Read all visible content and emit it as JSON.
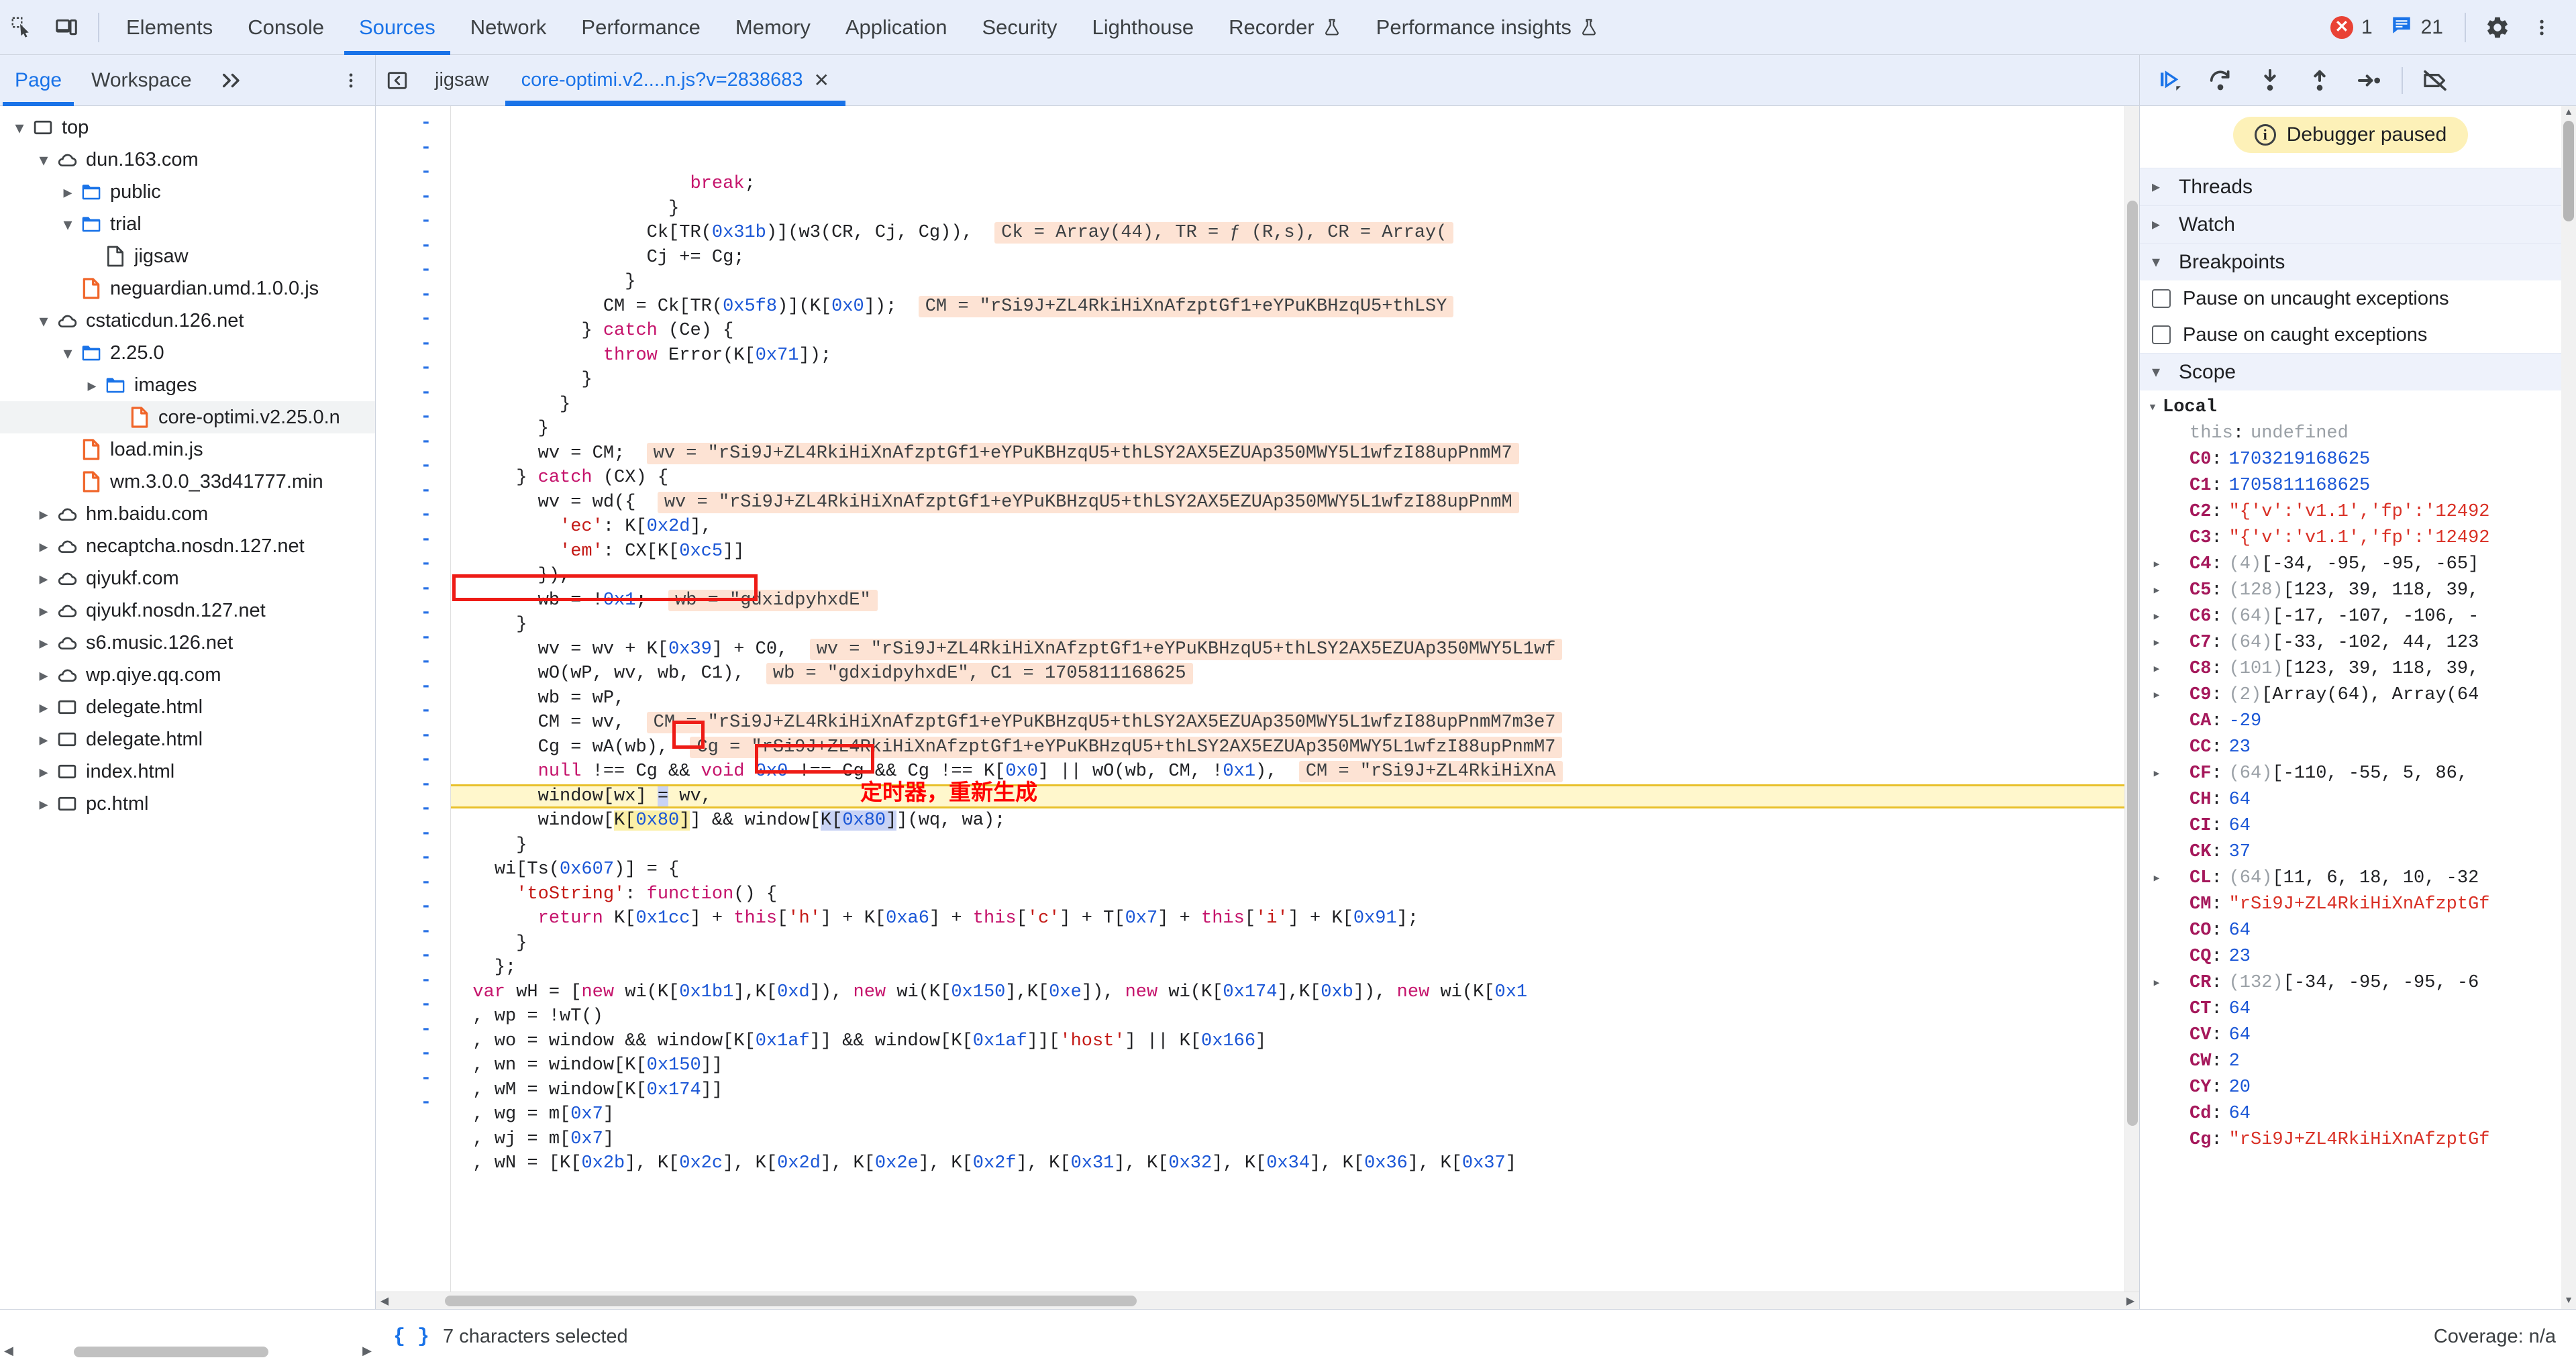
{
  "toolbar": {
    "inspect_icon": "inspect-cursor-icon",
    "device_icon": "device-toolbar-icon",
    "tabs": [
      {
        "label": "Elements",
        "active": false,
        "flask": false
      },
      {
        "label": "Console",
        "active": false,
        "flask": false
      },
      {
        "label": "Sources",
        "active": true,
        "flask": false
      },
      {
        "label": "Network",
        "active": false,
        "flask": false
      },
      {
        "label": "Performance",
        "active": false,
        "flask": false
      },
      {
        "label": "Memory",
        "active": false,
        "flask": false
      },
      {
        "label": "Application",
        "active": false,
        "flask": false
      },
      {
        "label": "Security",
        "active": false,
        "flask": false
      },
      {
        "label": "Lighthouse",
        "active": false,
        "flask": false
      },
      {
        "label": "Recorder",
        "active": false,
        "flask": true
      },
      {
        "label": "Performance insights",
        "active": false,
        "flask": true
      }
    ],
    "error_count": "1",
    "message_count": "21",
    "settings_icon": "gear-icon",
    "more_icon": "more-vertical-icon"
  },
  "navigator": {
    "tabs": [
      {
        "label": "Page",
        "active": true
      },
      {
        "label": "Workspace",
        "active": false
      }
    ],
    "overflow_icon": "chevron-double-right-icon",
    "more_icon": "more-vertical-icon",
    "tree": [
      {
        "label": "top",
        "icon": "frame-icon",
        "indent": 0,
        "state": "open",
        "selected": false
      },
      {
        "label": "dun.163.com",
        "icon": "cloud-icon",
        "indent": 1,
        "state": "open",
        "selected": false
      },
      {
        "label": "public",
        "icon": "folder-icon",
        "indent": 2,
        "state": "closed",
        "selected": false
      },
      {
        "label": "trial",
        "icon": "folder-icon",
        "indent": 2,
        "state": "open",
        "selected": false
      },
      {
        "label": "jigsaw",
        "icon": "file-doc-icon",
        "indent": 3,
        "state": "empty",
        "selected": false
      },
      {
        "label": "neguardian.umd.1.0.0.js",
        "icon": "file-js-icon",
        "indent": 2,
        "state": "empty",
        "selected": false
      },
      {
        "label": "cstaticdun.126.net",
        "icon": "cloud-icon",
        "indent": 1,
        "state": "open",
        "selected": false
      },
      {
        "label": "2.25.0",
        "icon": "folder-icon",
        "indent": 2,
        "state": "open",
        "selected": false
      },
      {
        "label": "images",
        "icon": "folder-icon",
        "indent": 3,
        "state": "closed",
        "selected": false
      },
      {
        "label": "core-optimi.v2.25.0.n",
        "icon": "file-js-icon",
        "indent": 4,
        "state": "empty",
        "selected": true
      },
      {
        "label": "load.min.js",
        "icon": "file-js-icon",
        "indent": 2,
        "state": "empty",
        "selected": false
      },
      {
        "label": "wm.3.0.0_33d41777.min",
        "icon": "file-js-icon",
        "indent": 2,
        "state": "empty",
        "selected": false
      },
      {
        "label": "hm.baidu.com",
        "icon": "cloud-icon",
        "indent": 1,
        "state": "closed",
        "selected": false
      },
      {
        "label": "necaptcha.nosdn.127.net",
        "icon": "cloud-icon",
        "indent": 1,
        "state": "closed",
        "selected": false
      },
      {
        "label": "qiyukf.com",
        "icon": "cloud-icon",
        "indent": 1,
        "state": "closed",
        "selected": false
      },
      {
        "label": "qiyukf.nosdn.127.net",
        "icon": "cloud-icon",
        "indent": 1,
        "state": "closed",
        "selected": false
      },
      {
        "label": "s6.music.126.net",
        "icon": "cloud-icon",
        "indent": 1,
        "state": "closed",
        "selected": false
      },
      {
        "label": "wp.qiye.qq.com",
        "icon": "cloud-icon",
        "indent": 1,
        "state": "closed",
        "selected": false
      },
      {
        "label": "delegate.html",
        "icon": "frame-icon",
        "indent": 1,
        "state": "closed",
        "selected": false
      },
      {
        "label": "delegate.html",
        "icon": "frame-icon",
        "indent": 1,
        "state": "closed",
        "selected": false
      },
      {
        "label": "index.html",
        "icon": "frame-icon",
        "indent": 1,
        "state": "closed",
        "selected": false
      },
      {
        "label": "pc.html",
        "icon": "frame-icon",
        "indent": 1,
        "state": "closed",
        "selected": false
      }
    ]
  },
  "editor": {
    "sidebar_toggle_icon": "show-navigator-icon",
    "tabs": [
      {
        "label": "jigsaw",
        "active": false,
        "closable": false
      },
      {
        "label": "core-optimi.v2....n.js?v=2838683",
        "active": true,
        "closable": true,
        "close_label": "✕"
      }
    ],
    "gutter_marker": "-",
    "annotation_cn": "定时器，重新生成",
    "inline_values": {
      "ck_array": "Ck = Array(44), TR = ƒ (R,s), CR = Array(",
      "cm_value": "CM = \"rSi9J+ZL4RkiHiXnAfzptGf1+eYPuKBHzqU5+thLSY",
      "wv_long": "wv = \"rSi9J+ZL4RkiHiXnAfzptGf1+eYPuKBHzqU5+thLSY2AX5EZUAp350MWY5L1wfzI88upPnmM7",
      "wv_long2": "wv = \"rSi9J+ZL4RkiHiXnAfzptGf1+eYPuKBHzqU5+thLSY2AX5EZUAp350MWY5L1wfzI88upPnmM",
      "wb_value": "wb = \"gdxidpyhxdE\"",
      "wv_c0": "wv = \"rSi9J+ZL4RkiHiXnAfzptGf1+eYPuKBHzqU5+thLSY2AX5EZUAp350MWY5L1wf",
      "wb_c1": "wb = \"gdxidpyhxdE\", C1 = 1705811168625",
      "cm_wv": "CM = \"rSi9J+ZL4RkiHiXnAfzptGf1+eYPuKBHzqU5+thLSY2AX5EZUAp350MWY5L1wfzI88upPnmM7m3e7",
      "cg_wa": "Cg = \"rSi9J+ZL4RkiHiXnAfzptGf1+eYPuKBHzqU5+thLSY2AX5EZUAp350MWY5L1wfzI88upPnmM7",
      "cm_null": "CM = \"rSi9J+ZL4RkiHiXnA"
    }
  },
  "debugger": {
    "buttons": [
      {
        "name": "resume-script-execution",
        "icon": "resume-icon"
      },
      {
        "name": "step-over",
        "icon": "step-over-icon"
      },
      {
        "name": "step-into",
        "icon": "step-into-icon"
      },
      {
        "name": "step-out",
        "icon": "step-out-icon"
      },
      {
        "name": "step",
        "icon": "step-icon"
      },
      {
        "name": "deactivate-breakpoints",
        "icon": "deactivate-breakpoints-icon"
      }
    ],
    "paused_message": "Debugger paused",
    "sections": [
      {
        "label": "Threads",
        "expanded": false
      },
      {
        "label": "Watch",
        "expanded": false
      },
      {
        "label": "Breakpoints",
        "expanded": true
      }
    ],
    "breakpoint_options": [
      {
        "label": "Pause on uncaught exceptions",
        "checked": false
      },
      {
        "label": "Pause on caught exceptions",
        "checked": false
      }
    ],
    "scope_label": "Scope",
    "local_label": "Local",
    "scope_vars": [
      {
        "name": "this",
        "value": "undefined",
        "type": "undef",
        "expandable": false
      },
      {
        "name": "C0",
        "value": "1703219168625",
        "type": "num",
        "expandable": false
      },
      {
        "name": "C1",
        "value": "1705811168625",
        "type": "num",
        "expandable": false
      },
      {
        "name": "C2",
        "value": "\"{'v':'v1.1','fp':'12492",
        "type": "str",
        "expandable": false
      },
      {
        "name": "C3",
        "value": "\"{'v':'v1.1','fp':'12492",
        "type": "str",
        "expandable": false
      },
      {
        "name": "C4",
        "count": "(4)",
        "value": "[-34, -95, -95, -65]",
        "type": "arr",
        "expandable": true
      },
      {
        "name": "C5",
        "count": "(128)",
        "value": "[123, 39, 118, 39,",
        "type": "arr",
        "expandable": true
      },
      {
        "name": "C6",
        "count": "(64)",
        "value": "[-17, -107, -106, -",
        "type": "arr",
        "expandable": true
      },
      {
        "name": "C7",
        "count": "(64)",
        "value": "[-33, -102, 44, 123",
        "type": "arr",
        "expandable": true
      },
      {
        "name": "C8",
        "count": "(101)",
        "value": "[123, 39, 118, 39,",
        "type": "arr",
        "expandable": true
      },
      {
        "name": "C9",
        "count": "(2)",
        "value": "[Array(64), Array(64",
        "type": "arr",
        "expandable": true
      },
      {
        "name": "CA",
        "value": "-29",
        "type": "num",
        "expandable": false
      },
      {
        "name": "CC",
        "value": "23",
        "type": "num",
        "expandable": false
      },
      {
        "name": "CF",
        "count": "(64)",
        "value": "[-110, -55, 5, 86,",
        "type": "arr",
        "expandable": true
      },
      {
        "name": "CH",
        "value": "64",
        "type": "num",
        "expandable": false
      },
      {
        "name": "CI",
        "value": "64",
        "type": "num",
        "expandable": false
      },
      {
        "name": "CK",
        "value": "37",
        "type": "num",
        "expandable": false
      },
      {
        "name": "CL",
        "count": "(64)",
        "value": "[11, 6, 18, 10, -32",
        "type": "arr",
        "expandable": true
      },
      {
        "name": "CM",
        "value": "\"rSi9J+ZL4RkiHiXnAfzptGf",
        "type": "str",
        "expandable": false
      },
      {
        "name": "CO",
        "value": "64",
        "type": "num",
        "expandable": false
      },
      {
        "name": "CQ",
        "value": "23",
        "type": "num",
        "expandable": false
      },
      {
        "name": "CR",
        "count": "(132)",
        "value": "[-34, -95, -95, -6",
        "type": "arr",
        "expandable": true
      },
      {
        "name": "CT",
        "value": "64",
        "type": "num",
        "expandable": false
      },
      {
        "name": "CV",
        "value": "64",
        "type": "num",
        "expandable": false
      },
      {
        "name": "CW",
        "value": "2",
        "type": "num",
        "expandable": false
      },
      {
        "name": "CY",
        "value": "20",
        "type": "num",
        "expandable": false
      },
      {
        "name": "Cd",
        "value": "64",
        "type": "num",
        "expandable": false
      },
      {
        "name": "Cg",
        "value": "\"rSi9J+ZL4RkiHiXnAfzptGf",
        "type": "str",
        "expandable": false
      }
    ]
  },
  "status_bar": {
    "format_icon": "pretty-print-braces-icon",
    "selection_text": "7 characters selected",
    "coverage_text": "Coverage: n/a"
  },
  "colors": {
    "accent": "#1a73e8",
    "error": "#e94235",
    "paused": "#fdf1b8",
    "inline_hint": "#fde3d4",
    "exec_line": "#fff7cc",
    "annotation": "#ff0000"
  }
}
